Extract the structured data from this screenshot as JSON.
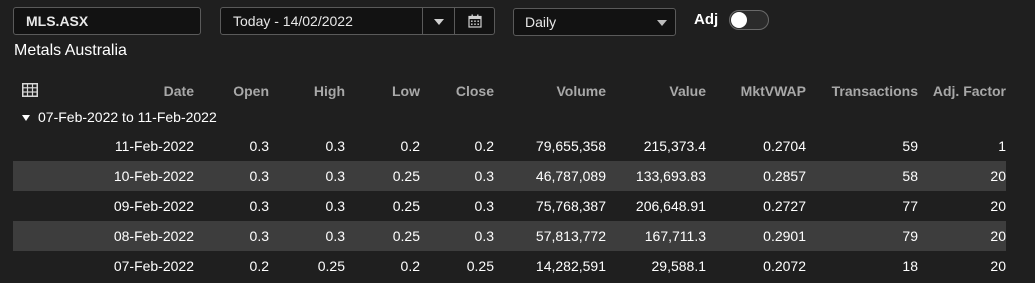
{
  "toolbar": {
    "ticker": "MLS.ASX",
    "date_range": "Today - 14/02/2022",
    "frequency": "Daily",
    "adj_label": "Adj",
    "adj_enabled": false
  },
  "company_name": "Metals Australia",
  "table": {
    "columns": [
      "Date",
      "Open",
      "High",
      "Low",
      "Close",
      "Volume",
      "Value",
      "MktVWAP",
      "Transactions",
      "Adj. Factor"
    ],
    "group_label": "07-Feb-2022 to 11-Feb-2022",
    "rows": [
      [
        "11-Feb-2022",
        "0.3",
        "0.3",
        "0.2",
        "0.2",
        "79,655,358",
        "215,373.4",
        "0.2704",
        "59",
        "1"
      ],
      [
        "10-Feb-2022",
        "0.3",
        "0.3",
        "0.25",
        "0.3",
        "46,787,089",
        "133,693.83",
        "0.2857",
        "58",
        "20"
      ],
      [
        "09-Feb-2022",
        "0.3",
        "0.3",
        "0.25",
        "0.3",
        "75,768,387",
        "206,648.91",
        "0.2727",
        "77",
        "20"
      ],
      [
        "08-Feb-2022",
        "0.3",
        "0.3",
        "0.25",
        "0.3",
        "57,813,772",
        "167,711.3",
        "0.2901",
        "79",
        "20"
      ],
      [
        "07-Feb-2022",
        "0.2",
        "0.25",
        "0.2",
        "0.25",
        "14,282,591",
        "29,588.1",
        "0.2072",
        "18",
        "20"
      ]
    ]
  },
  "icons": {
    "table": "table-grid-icon",
    "dropdown": "chevron-down-icon",
    "calendar": "calendar-icon",
    "group_toggle": "caret-down-icon"
  },
  "colors": {
    "background": "#1f1f1f",
    "alt_row": "#3d3d3d",
    "header_text": "#a8a8a8"
  }
}
